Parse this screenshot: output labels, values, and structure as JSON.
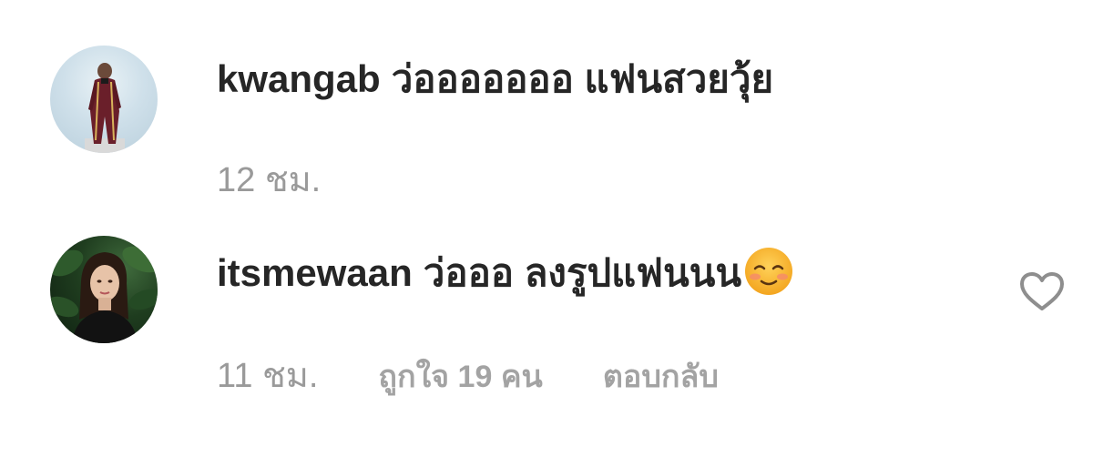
{
  "comments": [
    {
      "username": "kwangab",
      "text": "ว่อออออออ แฟนสวยวุ้ย",
      "time": "12 ชม."
    },
    {
      "username": "itsmewaan",
      "text": "ว่อออ ลงรูปแฟนนน",
      "emoji": "smiling-face-emoji",
      "time": "11 ชม.",
      "likes": "ถูกใจ 19 คน",
      "reply": "ตอบกลับ"
    }
  ],
  "icons": {
    "like": "heart-outline-icon"
  },
  "colors": {
    "text": "#262626",
    "meta": "#9a9a9a"
  }
}
